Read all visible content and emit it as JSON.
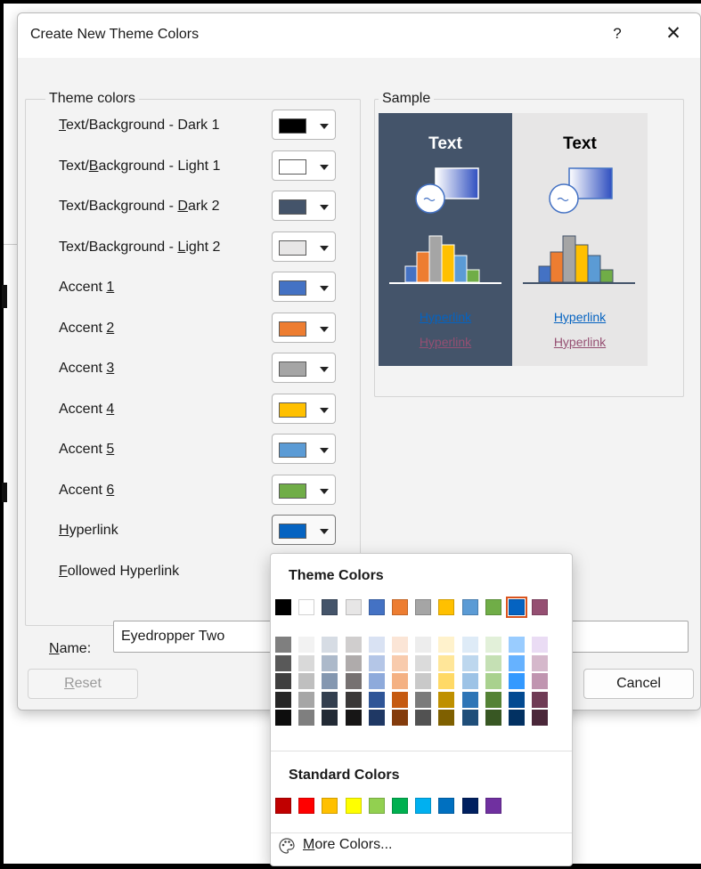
{
  "dialog": {
    "title": "Create New Theme Colors",
    "help_label": "?",
    "close_label": "✕"
  },
  "theme_colors": {
    "legend": "Theme colors",
    "rows": [
      {
        "pre": "",
        "u": "T",
        "post": "ext/Background - Dark 1",
        "color": "#000000"
      },
      {
        "pre": "Text/",
        "u": "B",
        "post": "ackground - Light 1",
        "color": "#ffffff"
      },
      {
        "pre": "Text/Background - ",
        "u": "D",
        "post": "ark 2",
        "color": "#44546a"
      },
      {
        "pre": "Text/Background - ",
        "u": "L",
        "post": "ight 2",
        "color": "#e7e6e6"
      },
      {
        "pre": "Accent ",
        "u": "1",
        "post": "",
        "color": "#4472c4"
      },
      {
        "pre": "Accent ",
        "u": "2",
        "post": "",
        "color": "#ed7d31"
      },
      {
        "pre": "Accent ",
        "u": "3",
        "post": "",
        "color": "#a5a5a5"
      },
      {
        "pre": "Accent ",
        "u": "4",
        "post": "",
        "color": "#ffc000"
      },
      {
        "pre": "Accent ",
        "u": "5",
        "post": "",
        "color": "#5b9bd5"
      },
      {
        "pre": "Accent ",
        "u": "6",
        "post": "",
        "color": "#70ad47"
      },
      {
        "pre": "",
        "u": "H",
        "post": "yperlink",
        "color": "#0563c1"
      },
      {
        "pre": "",
        "u": "F",
        "post": "ollowed Hyperlink",
        "color": "#954f72"
      }
    ]
  },
  "sample": {
    "legend": "Sample",
    "dark_text": "Text",
    "light_text": "Text",
    "hyperlink": "Hyperlink",
    "followed_hyperlink": "Hyperlink"
  },
  "name": {
    "label_u": "N",
    "label_rest": "ame:",
    "value": "Eyedropper Two"
  },
  "buttons": {
    "reset_u": "R",
    "reset_rest": "eset",
    "cancel": "Cancel"
  },
  "picker": {
    "theme_header": "Theme Colors",
    "theme_colors": [
      "#000000",
      "#ffffff",
      "#44546a",
      "#e7e6e6",
      "#4472c4",
      "#ed7d31",
      "#a5a5a5",
      "#ffc000",
      "#5b9bd5",
      "#70ad47",
      "#0563c1",
      "#954f72"
    ],
    "selected_index": 10,
    "shade_columns": [
      [
        "#7f7f7f",
        "#595959",
        "#3f3f3f",
        "#262626",
        "#0d0d0d"
      ],
      [
        "#f2f2f2",
        "#d9d9d9",
        "#bfbfbf",
        "#a6a6a6",
        "#7f7f7f"
      ],
      [
        "#d6dce4",
        "#acb9ca",
        "#8497b0",
        "#333f4f",
        "#222a35"
      ],
      [
        "#d0cece",
        "#afabab",
        "#767171",
        "#3a3838",
        "#171616"
      ],
      [
        "#d9e2f3",
        "#b4c6e7",
        "#8eaadb",
        "#2f5597",
        "#1f3864"
      ],
      [
        "#fbe5d6",
        "#f8cbad",
        "#f4b183",
        "#c55a11",
        "#843c0c"
      ],
      [
        "#ededed",
        "#dbdbdb",
        "#c9c9c9",
        "#7b7b7b",
        "#525252"
      ],
      [
        "#fff2cc",
        "#ffe699",
        "#ffd966",
        "#bf9000",
        "#7f6000"
      ],
      [
        "#deebf7",
        "#bdd7ee",
        "#9dc3e6",
        "#2e75b6",
        "#1f4e79"
      ],
      [
        "#e2f0d9",
        "#c5e0b4",
        "#a9d18e",
        "#548235",
        "#385723"
      ],
      [
        "#99ccff",
        "#66b2ff",
        "#3399ff",
        "#034a91",
        "#023162"
      ],
      [
        "#eadcf4",
        "#d5b8cb",
        "#c095b0",
        "#6f3b55",
        "#4a2739"
      ]
    ],
    "standard_header": "Standard Colors",
    "standard_colors": [
      "#c00000",
      "#ff0000",
      "#ffc000",
      "#ffff00",
      "#92d050",
      "#00b050",
      "#00b0f0",
      "#0070c0",
      "#002060",
      "#7030a0"
    ],
    "more_u": "M",
    "more_rest": "ore Colors..."
  }
}
